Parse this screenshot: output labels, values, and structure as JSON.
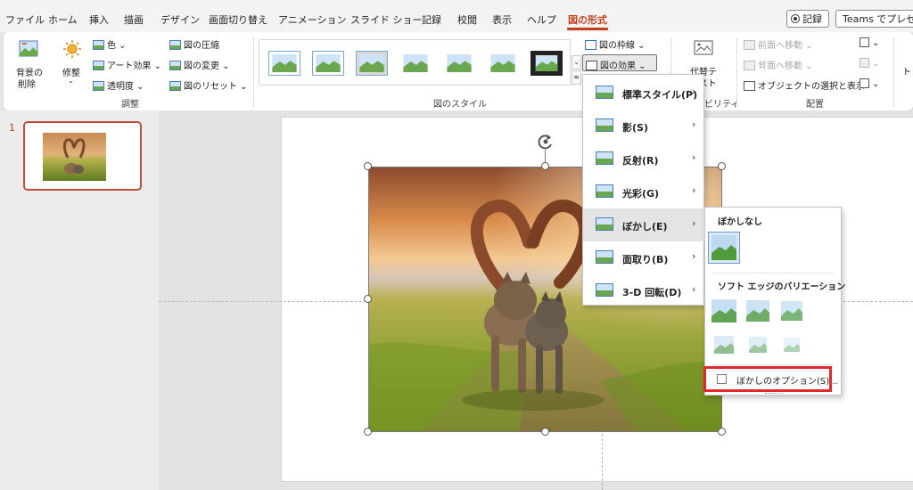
{
  "menu": {
    "tabs": [
      "ファイル",
      "ホーム",
      "挿入",
      "描画",
      "デザイン",
      "画面切り替え",
      "アニメーション",
      "スライド ショー",
      "記録",
      "校閲",
      "表示",
      "ヘルプ",
      "図の形式"
    ],
    "active_tab": "図の形式",
    "record_label": "記録",
    "teams_label": "Teams でプレゼン"
  },
  "ribbon": {
    "remove_bg_line1": "背景の",
    "remove_bg_line2": "削除",
    "corrections": "修整",
    "color": "色",
    "artistic_effects": "アート効果",
    "transparency": "透明度",
    "compress": "図の圧縮",
    "change_picture": "図の変更",
    "reset_picture": "図のリセット",
    "adjust_group": "調整",
    "picture_styles_group": "図のスタイル",
    "picture_border": "図の枠線",
    "picture_effects": "図の効果",
    "alt_text_line1": "代替テ",
    "alt_text_line2": "キスト",
    "accessibility_group": "ビリティ",
    "bring_forward": "前面へ移動",
    "send_backward": "背面へ移動",
    "selection_pane": "オブジェクトの選択と表示",
    "arrange_group": "配置",
    "crop_partial": "トリ"
  },
  "slides": {
    "number": "1"
  },
  "effects_menu": {
    "items": [
      {
        "label": "標準スタイル(P)"
      },
      {
        "label": "影(S)"
      },
      {
        "label": "反射(R)"
      },
      {
        "label": "光彩(G)"
      },
      {
        "label": "ぼかし(E)"
      },
      {
        "label": "面取り(B)"
      },
      {
        "label": "3-D 回転(D)"
      }
    ],
    "hover_index": 4
  },
  "blur_submenu": {
    "no_blur_heading": "ぼかしなし",
    "variations_heading": "ソフト エッジのバリエーション",
    "options_label": "ぼかしのオプション(S)..."
  },
  "colors": {
    "accent": "#c43e1c",
    "highlight": "#e3262c",
    "selected_slide_border": "#c0503b"
  }
}
